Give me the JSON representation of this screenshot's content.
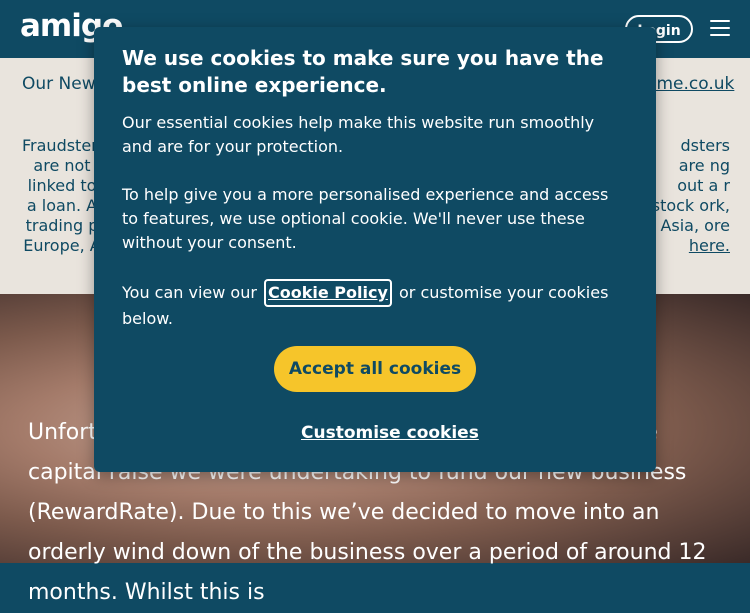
{
  "header": {
    "logo_text": "amigo",
    "login_label": "Login",
    "menu_icon": "hamburger-menu-icon"
  },
  "notice": {
    "line1_start": "Our New",
    "line1_end": "eme.co.uk",
    "fraud_left": "Fraudsters are not linked to a loan. A trading p Europe, A",
    "fraud_right": "dsters are ng out a r stock ork, Asia, ore",
    "here_link": "here."
  },
  "hero": {
    "paragraph": "Unfortunately we were unable to complete it through the capital raise we were undertaking to fund our new business (RewardRate). Due to this we’ve decided to move into an orderly wind down of the business over a period of around 12 months. Whilst this is"
  },
  "cookie_modal": {
    "title": "We use cookies to make sure you have the best online experience.",
    "para1": "Our essential cookies help make this website run smoothly and are for your protection.",
    "para2": "To help give you a more personalised experience and access to features, we use optional cookie. We'll never use these without your consent.",
    "para3_prefix": "You can view our",
    "cookie_policy_link": "Cookie Policy",
    "para3_suffix": "or customise your cookies below.",
    "accept_label": "Accept all cookies",
    "customise_label": "Customise cookies"
  },
  "colors": {
    "primary": "#0f4a63",
    "accent": "#f6c52a",
    "notice_bg": "#e9e4dd"
  }
}
